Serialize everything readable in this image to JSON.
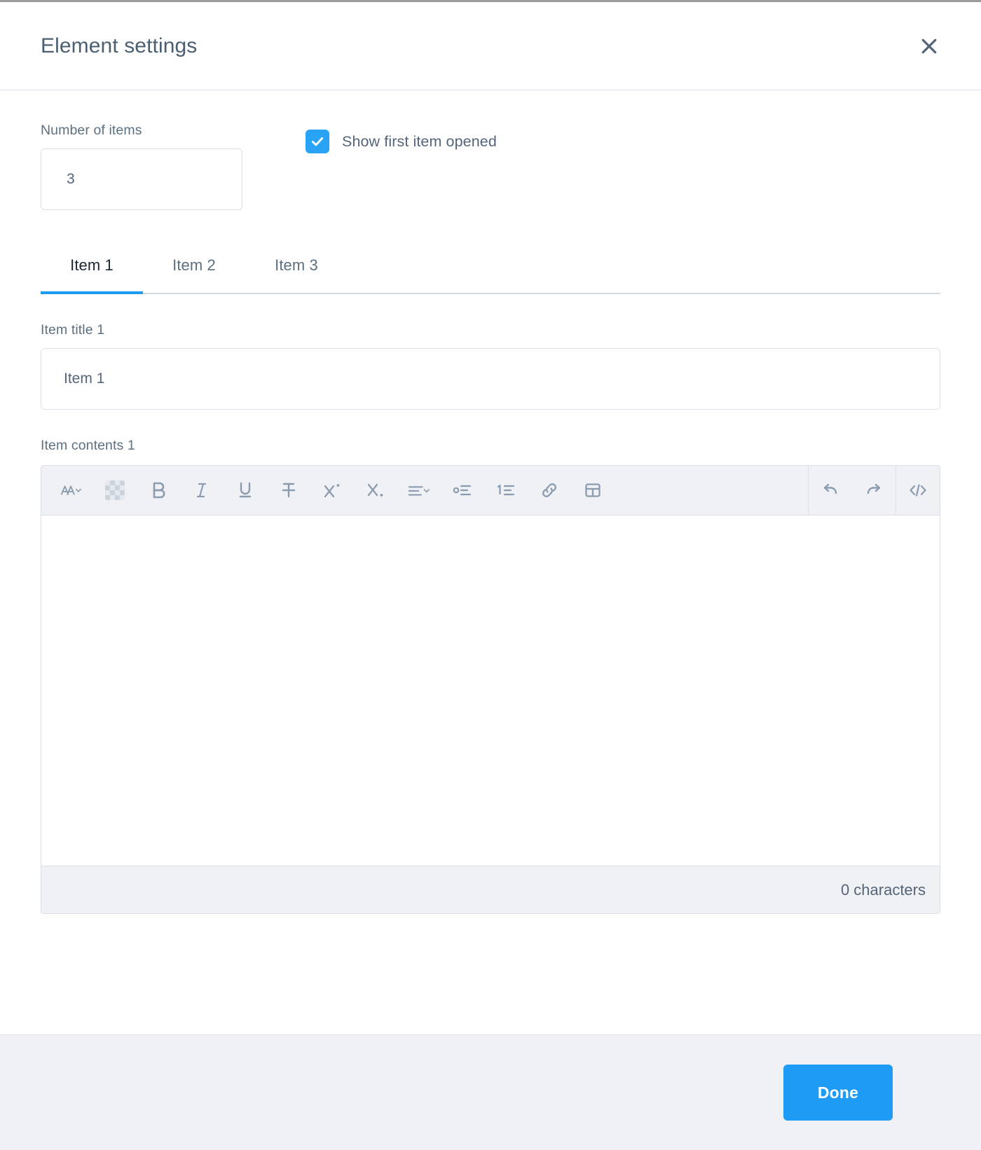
{
  "dialog": {
    "title": "Element settings",
    "close_icon": "close-icon"
  },
  "settings": {
    "number_of_items_label": "Number of items",
    "number_of_items_value": "3",
    "show_first_item_label": "Show first item opened",
    "show_first_item_checked": true,
    "check_icon": "check-icon"
  },
  "tabs": {
    "active_index": 0,
    "items": [
      {
        "label": "Item 1"
      },
      {
        "label": "Item 2"
      },
      {
        "label": "Item 3"
      }
    ]
  },
  "item_title": {
    "label": "Item title 1",
    "value": "Item 1"
  },
  "item_contents": {
    "label": "Item contents 1",
    "value": "",
    "character_count": "0 characters"
  },
  "toolbar": {
    "buttons": [
      {
        "name": "font-style-icon",
        "title": "Font style"
      },
      {
        "name": "text-color-icon",
        "title": "Text color"
      },
      {
        "name": "bold-icon",
        "title": "Bold"
      },
      {
        "name": "italic-icon",
        "title": "Italic"
      },
      {
        "name": "underline-icon",
        "title": "Underline"
      },
      {
        "name": "strikethrough-icon",
        "title": "Strikethrough"
      },
      {
        "name": "superscript-icon",
        "title": "Superscript"
      },
      {
        "name": "subscript-icon",
        "title": "Subscript"
      },
      {
        "name": "align-icon",
        "title": "Align"
      },
      {
        "name": "bullet-list-icon",
        "title": "Unordered list"
      },
      {
        "name": "numbered-list-icon",
        "title": "Ordered list"
      },
      {
        "name": "link-icon",
        "title": "Link"
      },
      {
        "name": "table-icon",
        "title": "Table"
      }
    ],
    "history_buttons": [
      {
        "name": "undo-icon",
        "title": "Undo"
      },
      {
        "name": "redo-icon",
        "title": "Redo"
      }
    ],
    "code_button": {
      "name": "code-view-icon",
      "title": "Code view"
    }
  },
  "footer": {
    "done_label": "Done"
  },
  "colors": {
    "accent": "#1e9bf5",
    "checkbox": "#29a3f5",
    "text": "#54657a",
    "toolbar_bg": "#eff1f5",
    "border": "#dbe0e6"
  }
}
